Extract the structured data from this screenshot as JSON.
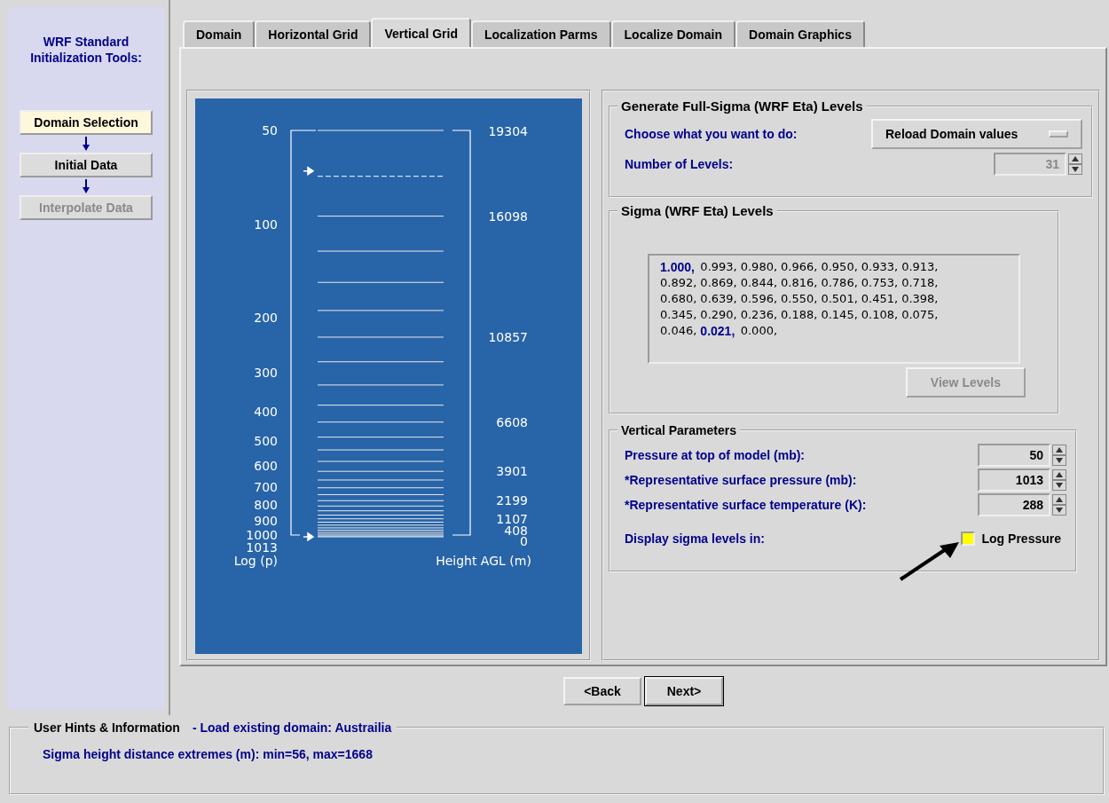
{
  "sidebar": {
    "title": "WRF Standard Initialization Tools:",
    "steps": [
      {
        "label": "Domain Selection",
        "selected": true,
        "disabled": false
      },
      {
        "label": "Initial Data",
        "selected": false,
        "disabled": false
      },
      {
        "label": "Interpolate Data",
        "selected": false,
        "disabled": true
      }
    ]
  },
  "tabs": [
    {
      "label": "Domain",
      "selected": false
    },
    {
      "label": "Horizontal Grid",
      "selected": false
    },
    {
      "label": "Vertical Grid",
      "selected": true
    },
    {
      "label": "Localization Parms",
      "selected": false
    },
    {
      "label": "Localize Domain",
      "selected": false
    },
    {
      "label": "Domain Graphics",
      "selected": false
    }
  ],
  "plot": {
    "pressure_labels": [
      "50",
      "100",
      "200",
      "300",
      "400",
      "500",
      "600",
      "700",
      "800",
      "900",
      "1000",
      "1013"
    ],
    "height_labels": [
      "19304",
      "16098",
      "10857",
      "6608",
      "3901",
      "2199",
      "1107",
      "408",
      "0"
    ],
    "left_axis_label": "Log (p)",
    "right_axis_label": "Height AGL (m)"
  },
  "generate": {
    "title": "Generate Full-Sigma (WRF Eta) Levels",
    "action_label": "Choose what you want to do:",
    "action_value": "Reload Domain values",
    "levels_label": "Number of Levels:",
    "levels_value": "31",
    "levels_disabled": true
  },
  "sigma": {
    "title": "Sigma (WRF Eta) Levels",
    "values": [
      {
        "text": "1.000,",
        "selected": true
      },
      {
        "text": "0.993,",
        "selected": false
      },
      {
        "text": "0.980,",
        "selected": false
      },
      {
        "text": "0.966,",
        "selected": false
      },
      {
        "text": "0.950,",
        "selected": false
      },
      {
        "text": "0.933,",
        "selected": false
      },
      {
        "text": "0.913,",
        "selected": false
      },
      {
        "text": "0.892,",
        "selected": false
      },
      {
        "text": "0.869,",
        "selected": false
      },
      {
        "text": "0.844,",
        "selected": false
      },
      {
        "text": "0.816,",
        "selected": false
      },
      {
        "text": "0.786,",
        "selected": false
      },
      {
        "text": "0.753,",
        "selected": false
      },
      {
        "text": "0.718,",
        "selected": false
      },
      {
        "text": "0.680,",
        "selected": false
      },
      {
        "text": "0.639,",
        "selected": false
      },
      {
        "text": "0.596,",
        "selected": false
      },
      {
        "text": "0.550,",
        "selected": false
      },
      {
        "text": "0.501,",
        "selected": false
      },
      {
        "text": "0.451,",
        "selected": false
      },
      {
        "text": "0.398,",
        "selected": false
      },
      {
        "text": "0.345,",
        "selected": false
      },
      {
        "text": "0.290,",
        "selected": false
      },
      {
        "text": "0.236,",
        "selected": false
      },
      {
        "text": "0.188,",
        "selected": false
      },
      {
        "text": "0.145,",
        "selected": false
      },
      {
        "text": "0.108,",
        "selected": false
      },
      {
        "text": "0.075,",
        "selected": false
      },
      {
        "text": "0.046,",
        "selected": false
      },
      {
        "text": "0.021,",
        "selected": true
      },
      {
        "text": "0.000,",
        "selected": false
      }
    ],
    "view_button": {
      "label": "View Levels",
      "disabled": true
    }
  },
  "vertical": {
    "title": "Vertical Parameters",
    "params": [
      {
        "label": "Pressure at top of model (mb):",
        "value": "50"
      },
      {
        "label": "*Representative surface pressure (mb):",
        "value": "1013"
      },
      {
        "label": "*Representative surface temperature (K):",
        "value": "288"
      }
    ],
    "display_label": "Display sigma levels in:",
    "log_pressure": {
      "label": "Log Pressure",
      "checked": true
    }
  },
  "nav": [
    {
      "label": "<Back",
      "default": false
    },
    {
      "label": "Next>",
      "default": true
    }
  ],
  "hints": {
    "title": "User Hints & Information",
    "subtitle": "- Load existing domain: Austrailia",
    "message": "Sigma height distance extremes (m):   min=56, max=1668"
  }
}
